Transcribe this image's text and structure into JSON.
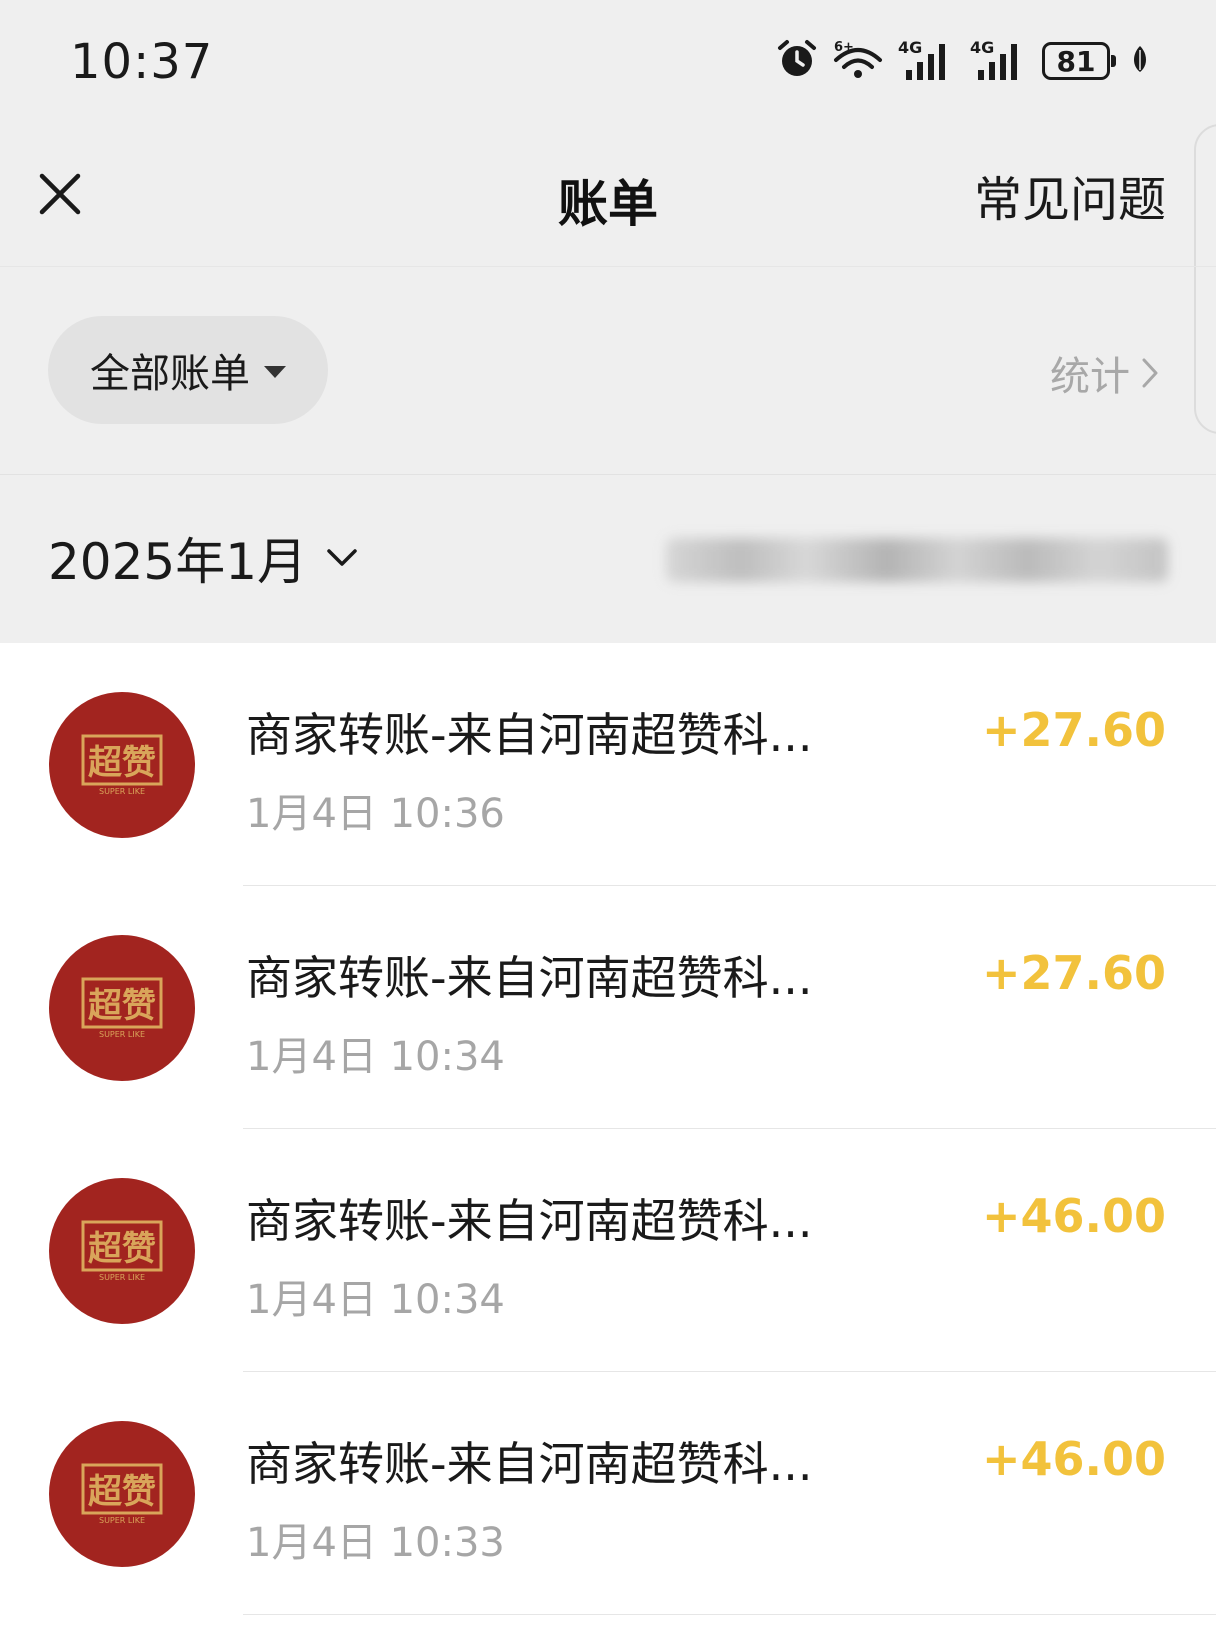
{
  "status_bar": {
    "time": "10:37",
    "net1": "4G",
    "net2": "4G",
    "battery": "81",
    "icons": [
      "alarm-icon",
      "wifi-icon",
      "signal-icon",
      "signal-icon",
      "battery-icon",
      "leaf-icon"
    ]
  },
  "nav": {
    "title": "账单",
    "faq": "常见问题"
  },
  "filter": {
    "label": "全部账单",
    "stats": "统计"
  },
  "month": {
    "label": "2025年1月"
  },
  "colors": {
    "amount": "#f2c23c",
    "avatar_bg": "#a2241f",
    "avatar_fg": "#d9a55a"
  },
  "transactions": [
    {
      "title": "商家转账-来自河南超赞科...",
      "time": "1月4日 10:36",
      "amount": "+27.60"
    },
    {
      "title": "商家转账-来自河南超赞科...",
      "time": "1月4日 10:34",
      "amount": "+27.60"
    },
    {
      "title": "商家转账-来自河南超赞科...",
      "time": "1月4日 10:34",
      "amount": "+46.00"
    },
    {
      "title": "商家转账-来自河南超赞科...",
      "time": "1月4日 10:33",
      "amount": "+46.00"
    }
  ],
  "avatar_logo": {
    "text": "超赞",
    "subtext": "SUPER LIKE"
  }
}
